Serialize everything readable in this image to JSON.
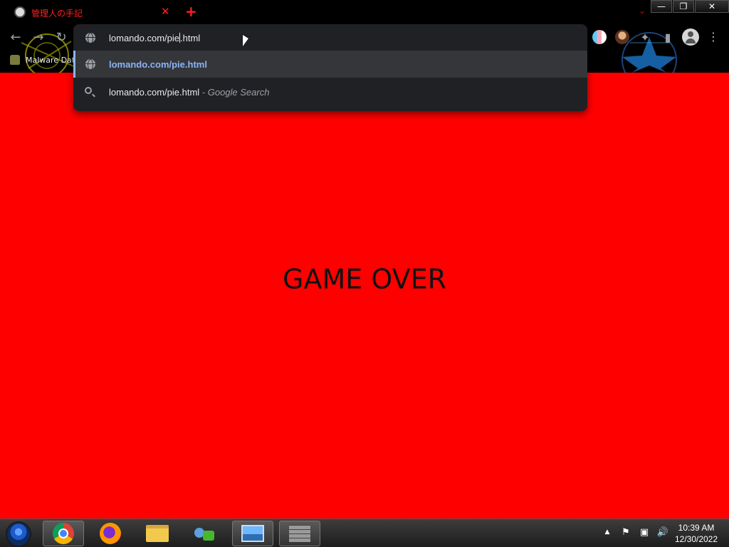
{
  "browser": {
    "tab": {
      "title": "管理人の手記",
      "close_icon": "close-icon"
    },
    "tab_search_icon": "chevron-down-icon",
    "window_controls": {
      "minimize": "—",
      "restore": "❐",
      "close": "✕"
    },
    "toolbar": {
      "back": "←",
      "forward": "→",
      "reload": "↻",
      "menu": "⋮"
    },
    "bookmarks": [
      {
        "label": "Malware Dat"
      }
    ]
  },
  "omnibox": {
    "input_before_caret": "lomando.com/pie",
    "input_after_caret": ".html",
    "suggestions": [
      {
        "icon": "globe-icon",
        "text": "lomando.com/pie.html",
        "selected": true
      },
      {
        "icon": "search-icon",
        "text": "lomando.com/pie.html",
        "suffix": " - Google Search",
        "selected": false
      }
    ]
  },
  "page": {
    "message": "GAME OVER",
    "background_color": "#ff0000"
  },
  "taskbar": {
    "pinned": [
      {
        "name": "chrome",
        "active": true
      },
      {
        "name": "firefox",
        "active": false
      },
      {
        "name": "file-explorer",
        "active": false
      },
      {
        "name": "messenger",
        "active": false
      },
      {
        "name": "photo-viewer",
        "active": true
      },
      {
        "name": "wall-app",
        "active": true
      }
    ],
    "tray": {
      "expand": "▲",
      "flag": "⚑",
      "network": "▣",
      "volume": "🔊"
    },
    "clock": {
      "time": "10:39 AM",
      "date": "12/30/2022"
    }
  }
}
